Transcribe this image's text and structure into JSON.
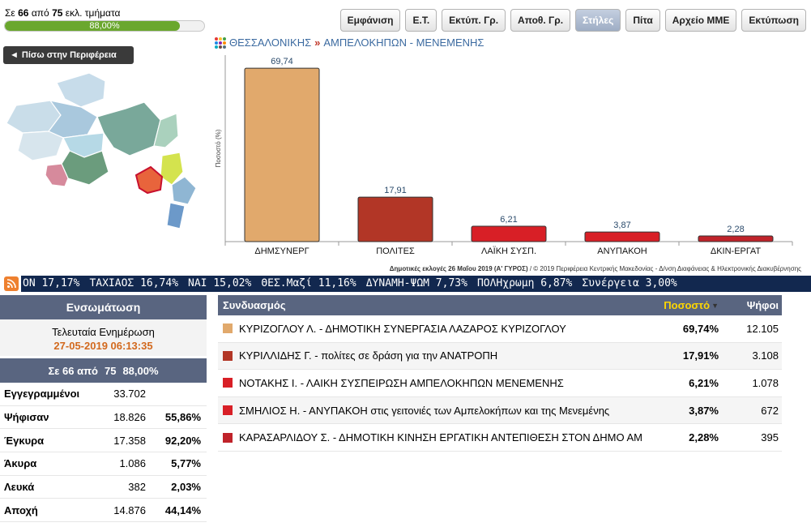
{
  "progress": {
    "prefix": "Σε",
    "counted": "66",
    "mid": "από",
    "total": "75",
    "suffix": "εκλ. τμήματα",
    "percent_label": "88,00%",
    "fraction": 0.88,
    "fill_color": "#6aa72e"
  },
  "toolbar": {
    "items": [
      {
        "label": "Εμφάνιση",
        "active": false
      },
      {
        "label": "Ε.Τ.",
        "active": false
      },
      {
        "label": "Εκτύπ. Γρ.",
        "active": false
      },
      {
        "label": "Αποθ. Γρ.",
        "active": false
      },
      {
        "label": "Στήλες",
        "active": true
      },
      {
        "label": "Πίτα",
        "active": false
      },
      {
        "label": "Αρχείο ΜΜΕ",
        "active": false
      },
      {
        "label": "Εκτύπωση",
        "active": false
      }
    ]
  },
  "back_button": {
    "arrow": "◄",
    "label": "Πίσω στην Περιφέρεια"
  },
  "breadcrumb": {
    "region": "ΘΕΣΣΑΛΟΝΙΚΗΣ",
    "separator": "»",
    "municipality": "ΑΜΠΕΛΟΚΗΠΩΝ - ΜΕΝΕΜΕΝΗΣ"
  },
  "chart_data": {
    "type": "bar",
    "categories": [
      "ΔΗΜΣΥΝΕΡΓ",
      "ΠΟΛΙΤΕΣ",
      "ΛΑΪΚΗ ΣΥΣΠ.",
      "ΑΝΥΠΑΚΟΗ",
      "ΔΚΙΝ-ΕΡΓΑΤ"
    ],
    "values": [
      69.74,
      17.91,
      6.21,
      3.87,
      2.28
    ],
    "value_labels": [
      "69,74",
      "17,91",
      "6,21",
      "3,87",
      "2,28"
    ],
    "colors": [
      "#e1a96c",
      "#b23626",
      "#d81f26",
      "#d81f26",
      "#c0232a"
    ],
    "ylabel": "Ποσοστό (%)",
    "ylim": [
      0,
      75
    ],
    "grid": false
  },
  "chart_credit": {
    "bold": "Δημοτικές εκλογές 26 Μαΐου 2019 (Α' ΓΥΡΟΣ)",
    "rest": " / © 2019 Περιφέρεια Κεντρικής Μακεδονίας - Δ/νση Διαφάνειας & Ηλεκτρονικής Διακυβέρνησης"
  },
  "ticker": {
    "items": [
      "ΟΝ 17,17%",
      "ΤΑΧΙΑΟΣ 16,74%",
      "ΝΑΙ 15,02%",
      "ΘΕΣ.Μαζί 11,16%",
      "ΔΥΝΑΜΗ-ΨΩΜ 7,73%",
      "ΠΟΛΗχρωμη 6,87%",
      "Συνέργεια 3,00%"
    ]
  },
  "left_panel": {
    "header": "Ενσωμάτωση",
    "update_label": "Τελευταία Ενημέρωση",
    "update_date": "27-05-2019 06:13:35",
    "summary": {
      "prefix": "Σε 66 από",
      "total": "75",
      "percent": "88,00%"
    },
    "rows": [
      {
        "label": "Εγγεγραμμένοι",
        "value": "33.702",
        "percent": ""
      },
      {
        "label": "Ψήφισαν",
        "value": "18.826",
        "percent": "55,86%"
      },
      {
        "label": "Έγκυρα",
        "value": "17.358",
        "percent": "92,20%"
      },
      {
        "label": "Άκυρα",
        "value": "1.086",
        "percent": "5,77%"
      },
      {
        "label": "Λευκά",
        "value": "382",
        "percent": "2,03%"
      },
      {
        "label": "Αποχή",
        "value": "14.876",
        "percent": "44,14%"
      }
    ]
  },
  "results": {
    "headers": {
      "name": "Συνδυασμός",
      "percent": "Ποσοστό",
      "votes": "Ψήφοι"
    },
    "rows": [
      {
        "color": "#e1a96c",
        "name": "ΚΥΡΙΖΟΓΛΟΥ Λ. - ΔΗΜΟΤΙΚΗ ΣΥΝΕΡΓΑΣΙΑ ΛΑΖΑΡΟΣ ΚΥΡΙΖΟΓΛΟΥ",
        "percent": "69,74%",
        "votes": "12.105"
      },
      {
        "color": "#b23626",
        "name": "ΚΥΡΙΛΛΙΔΗΣ Γ. - πολίτες σε δράση για την ΑΝΑΤΡΟΠΗ",
        "percent": "17,91%",
        "votes": "3.108"
      },
      {
        "color": "#d81f26",
        "name": "ΝΟΤΑΚΗΣ Ι. - ΛΑΙΚΗ ΣΥΣΠΕΙΡΩΣΗ ΑΜΠΕΛΟΚΗΠΩΝ ΜΕΝΕΜΕΝΗΣ",
        "percent": "6,21%",
        "votes": "1.078"
      },
      {
        "color": "#d81f26",
        "name": "ΣΜΗΛΙΟΣ Η. - ΑΝΥΠΑΚΟΗ στις γειτονιές των Αμπελοκήπων και της Μενεμένης",
        "percent": "3,87%",
        "votes": "672"
      },
      {
        "color": "#c0232a",
        "name": "ΚΑΡΑΣΑΡΛΙΔΟΥ Σ. - ΔΗΜΟΤΙΚΗ ΚΙΝΗΣΗ ΕΡΓΑΤΙΚΗ ΑΝΤΕΠΙΘΕΣΗ ΣΤΟΝ ΔΗΜΟ ΑΜ",
        "percent": "2,28%",
        "votes": "395"
      }
    ]
  },
  "map": {
    "highlight_color": "#e8643c"
  }
}
